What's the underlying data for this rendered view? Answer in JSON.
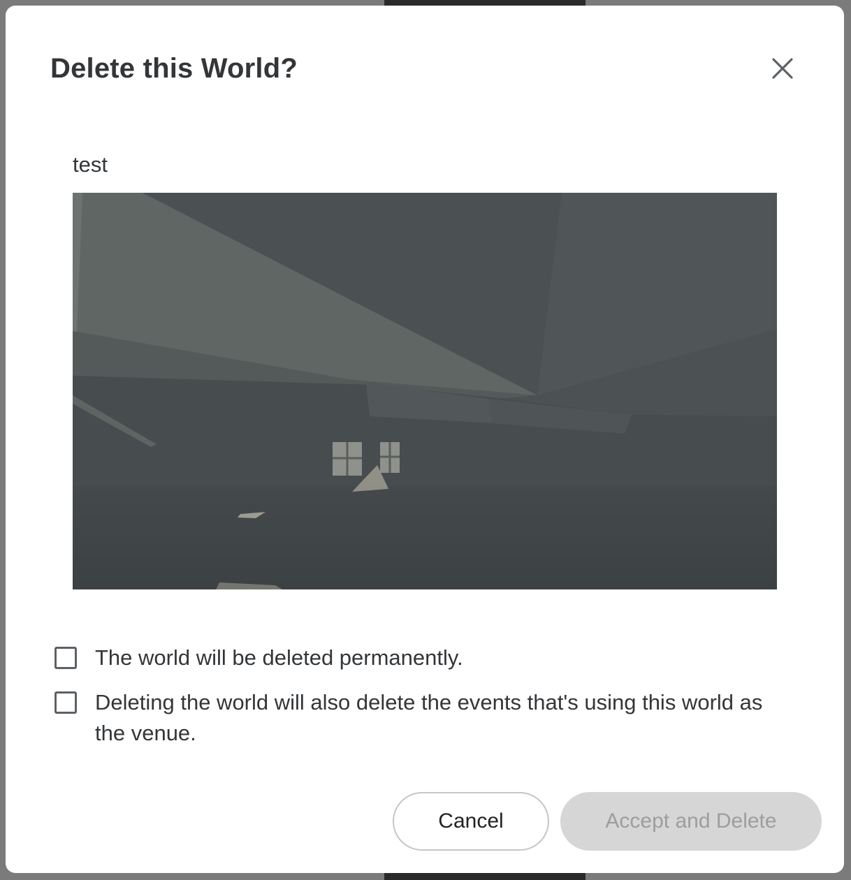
{
  "dialog": {
    "title": "Delete this World?",
    "close_icon": "close-icon"
  },
  "world": {
    "name": "test",
    "thumbnail_icon": "world-preview-image"
  },
  "confirmations": [
    {
      "label": "The world will be deleted permanently.",
      "checked": false
    },
    {
      "label": "Deleting the world will also delete the events that's using this world as the venue.",
      "checked": false
    }
  ],
  "actions": {
    "cancel_label": "Cancel",
    "delete_label": "Accept and Delete",
    "delete_enabled": false
  },
  "colors": {
    "text": "#333639",
    "disabled_button_bg": "#d6d6d6",
    "disabled_button_text": "#9d9d9d"
  }
}
